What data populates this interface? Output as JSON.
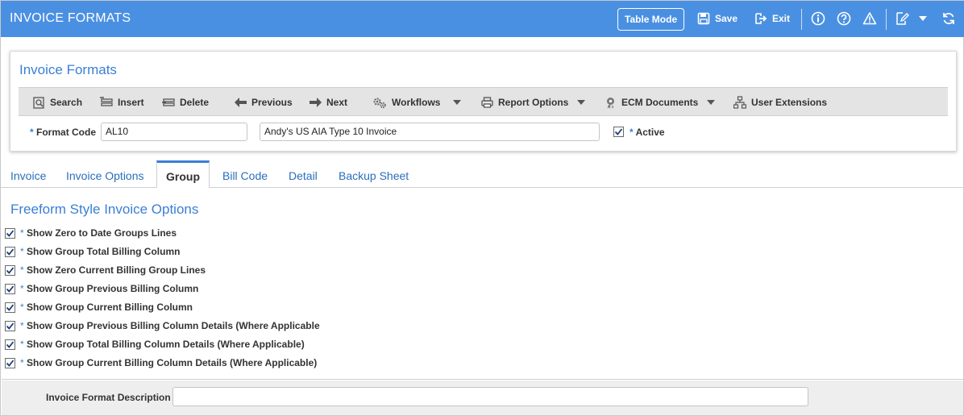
{
  "window": {
    "title": "INVOICE FORMATS",
    "table_mode_label": "Table Mode",
    "save_label": "Save",
    "exit_label": "Exit"
  },
  "header": {
    "title": "Invoice Formats",
    "toolbar": {
      "search": "Search",
      "insert": "Insert",
      "delete": "Delete",
      "previous": "Previous",
      "next": "Next",
      "workflows": "Workflows",
      "report_options": "Report Options",
      "ecm_documents": "ECM Documents",
      "user_extensions": "User Extensions"
    },
    "format_code_label": "Format Code",
    "format_code_value": "AL10",
    "description_value": "Andy's US AIA Type 10 Invoice",
    "active_label": "Active",
    "active_checked": true,
    "required_marker": "*"
  },
  "tabs": [
    {
      "label": "Invoice"
    },
    {
      "label": "Invoice Options"
    },
    {
      "label": "Group"
    },
    {
      "label": "Bill Code"
    },
    {
      "label": "Detail"
    },
    {
      "label": "Backup Sheet"
    }
  ],
  "active_tab": "Group",
  "section": {
    "title": "Freeform Style Invoice Options",
    "options": [
      {
        "label": "Show Zero to Date Groups Lines",
        "checked": true
      },
      {
        "label": "Show Group Total Billing Column",
        "checked": true
      },
      {
        "label": "Show Zero Current Billing Group Lines",
        "checked": true
      },
      {
        "label": "Show Group Previous Billing Column",
        "checked": true
      },
      {
        "label": "Show Group Current Billing Column",
        "checked": true
      },
      {
        "label": "Show Group Previous Billing Column Details (Where Applicable",
        "checked": true
      },
      {
        "label": "Show Group Total Billing Column Details (Where Applicable)",
        "checked": true
      },
      {
        "label": "Show Group Current Billing Column Details (Where Applicable)",
        "checked": true
      }
    ]
  },
  "footer": {
    "description_label": "Invoice Format Description",
    "description_value": ""
  },
  "colors": {
    "topbar": "#4a90e2",
    "accent": "#3a7fd5",
    "toolbar_bg": "#e4e4e4"
  },
  "icons": {
    "save": "save-icon",
    "exit": "exit-icon",
    "info": "info-icon",
    "help": "help-icon",
    "warning": "warning-icon",
    "edit": "edit-icon",
    "refresh": "refresh-icon"
  }
}
